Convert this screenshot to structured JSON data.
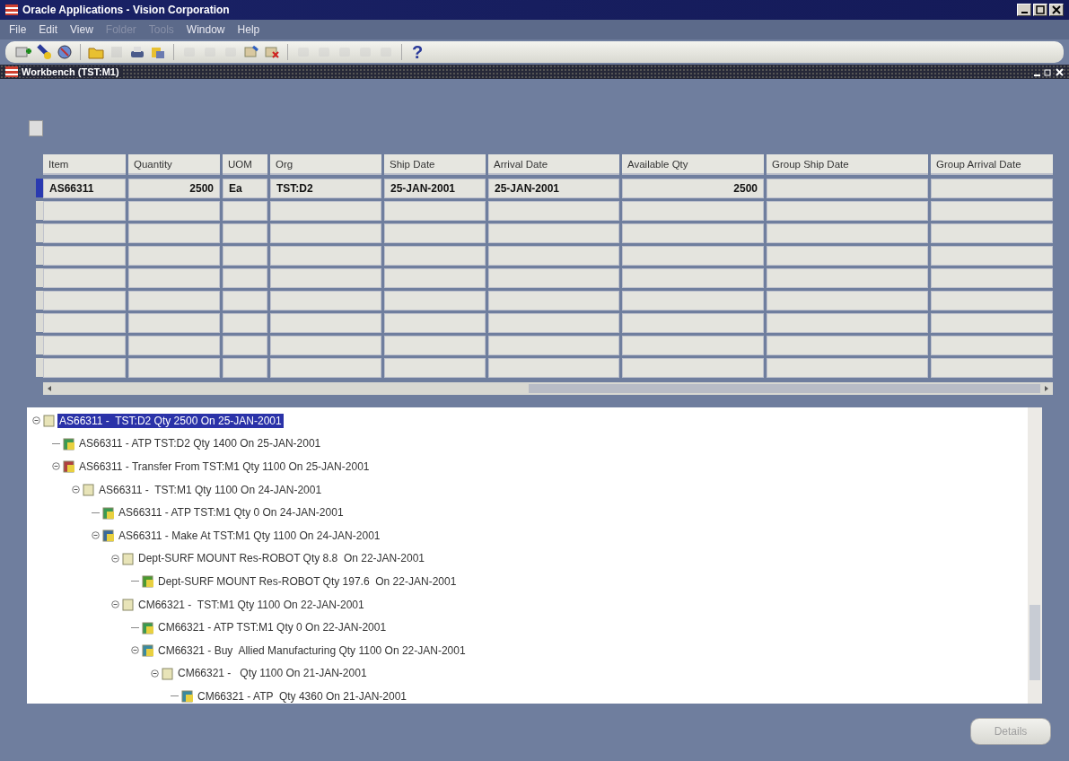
{
  "window": {
    "title": "Oracle Applications - Vision Corporation"
  },
  "menu": [
    {
      "label": "File",
      "disabled": false
    },
    {
      "label": "Edit",
      "disabled": false
    },
    {
      "label": "View",
      "disabled": false
    },
    {
      "label": "Folder",
      "disabled": true
    },
    {
      "label": "Tools",
      "disabled": true
    },
    {
      "label": "Window",
      "disabled": false
    },
    {
      "label": "Help",
      "disabled": false
    }
  ],
  "toolbar": [
    {
      "kind": "new",
      "disabled": false
    },
    {
      "kind": "find",
      "disabled": false
    },
    {
      "kind": "globe",
      "disabled": false
    },
    {
      "kind": "sep"
    },
    {
      "kind": "folder",
      "disabled": false
    },
    {
      "kind": "save",
      "disabled": true
    },
    {
      "kind": "print",
      "disabled": false
    },
    {
      "kind": "navigator",
      "disabled": false
    },
    {
      "kind": "sep"
    },
    {
      "kind": "cut",
      "disabled": true
    },
    {
      "kind": "copy",
      "disabled": true
    },
    {
      "kind": "paste",
      "disabled": true
    },
    {
      "kind": "newrec",
      "disabled": false
    },
    {
      "kind": "delrec",
      "disabled": false
    },
    {
      "kind": "sep"
    },
    {
      "kind": "edit",
      "disabled": true
    },
    {
      "kind": "attach",
      "disabled": true
    },
    {
      "kind": "folder2",
      "disabled": true
    },
    {
      "kind": "trans",
      "disabled": true
    },
    {
      "kind": "zoom",
      "disabled": true
    },
    {
      "kind": "sep"
    },
    {
      "kind": "help",
      "label": "?",
      "disabled": false
    }
  ],
  "workbench": {
    "title": "Workbench (TST:M1)"
  },
  "table": {
    "columns": [
      "Item",
      "Quantity",
      "UOM",
      "Org",
      "Ship Date",
      "Arrival Date",
      "Available Qty",
      "Group Ship Date",
      "Group Arrival Date"
    ],
    "rows": [
      {
        "selected": true,
        "cells": [
          "AS66311",
          "2500",
          "Ea",
          "TST:D2",
          "25-JAN-2001",
          "25-JAN-2001",
          "2500"
        ]
      }
    ]
  },
  "tree": [
    {
      "label": "AS66311 -  TST:D2 Qty 2500 On 25-JAN-2001",
      "kind": "supply",
      "selected": true,
      "expanded": true,
      "children": [
        {
          "label": "AS66311 - ATP TST:D2 Qty 1400 On 25-JAN-2001",
          "kind": "atp",
          "selected": false
        },
        {
          "label": "AS66311 - Transfer From TST:M1 Qty 1100 On 25-JAN-2001",
          "kind": "transfer",
          "selected": false,
          "expanded": true,
          "children": [
            {
              "label": "AS66311 -  TST:M1 Qty 1100 On 24-JAN-2001",
              "kind": "supply",
              "selected": false,
              "expanded": true,
              "children": [
                {
                  "label": "AS66311 - ATP TST:M1 Qty 0 On 24-JAN-2001",
                  "kind": "atp",
                  "selected": false
                },
                {
                  "label": "AS66311 - Make At TST:M1 Qty 1100 On 24-JAN-2001",
                  "kind": "make",
                  "selected": false,
                  "expanded": true,
                  "children": [
                    {
                      "label": "Dept-SURF MOUNT Res-ROBOT Qty 8.8  On 22-JAN-2001",
                      "kind": "supply",
                      "selected": false,
                      "expanded": true,
                      "children": [
                        {
                          "label": "Dept-SURF MOUNT Res-ROBOT Qty 197.6  On 22-JAN-2001",
                          "kind": "resource",
                          "selected": false
                        }
                      ]
                    },
                    {
                      "label": "CM66321 -  TST:M1 Qty 1100 On 22-JAN-2001",
                      "kind": "supply",
                      "selected": false,
                      "expanded": true,
                      "children": [
                        {
                          "label": "CM66321 - ATP TST:M1 Qty 0 On 22-JAN-2001",
                          "kind": "atp",
                          "selected": false
                        },
                        {
                          "label": "CM66321 - Buy  Allied Manufacturing Qty 1100 On 22-JAN-2001",
                          "kind": "buy",
                          "selected": false,
                          "expanded": true,
                          "children": [
                            {
                              "label": "CM66321 -   Qty 1100 On 21-JAN-2001",
                              "kind": "supply",
                              "selected": false,
                              "expanded": true,
                              "children": [
                                {
                                  "label": "CM66321 - ATP  Qty 4360 On 21-JAN-2001",
                                  "kind": "buy",
                                  "selected": false
                                }
                              ]
                            }
                          ]
                        }
                      ]
                    }
                  ]
                }
              ]
            }
          ]
        }
      ]
    }
  ],
  "details_button": {
    "label": "Details",
    "disabled": true
  }
}
